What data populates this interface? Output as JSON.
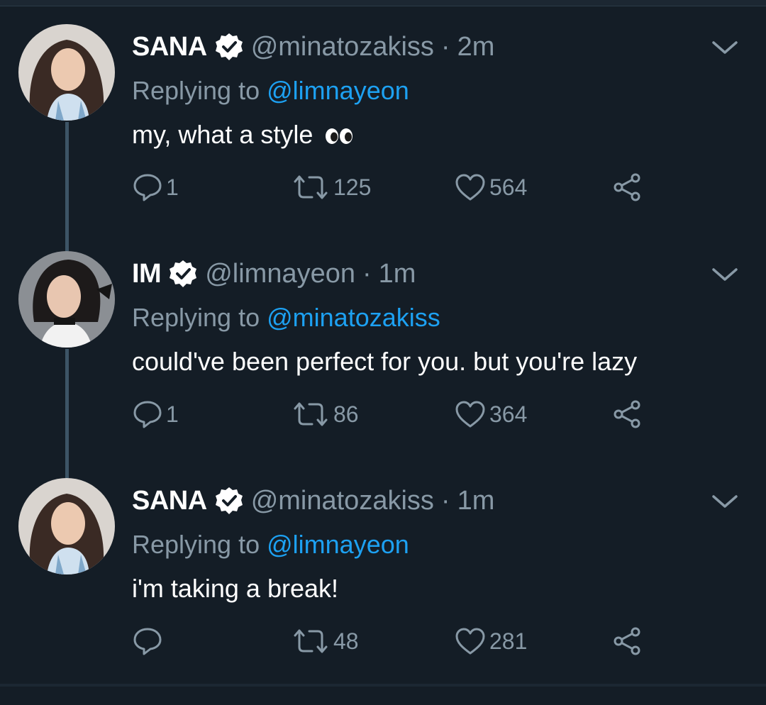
{
  "colors": {
    "background": "#141d26",
    "secondary_text": "#8899a6",
    "mention": "#1da1f2",
    "thread_line": "#3d5466"
  },
  "tweets": [
    {
      "name": "SANA",
      "handle": "@minatozakiss",
      "separator": "·",
      "time": "2m",
      "replying_prefix": "Replying to",
      "replying_to": "@limnayeon",
      "text": "my, what a style",
      "emoji": "eyes-emoji",
      "replies": "1",
      "retweets": "125",
      "likes": "564"
    },
    {
      "name": "IM",
      "handle": "@limnayeon",
      "separator": "·",
      "time": "1m",
      "replying_prefix": "Replying to",
      "replying_to": "@minatozakiss",
      "text": "could've been perfect for you. but you're lazy",
      "replies": "1",
      "retweets": "86",
      "likes": "364"
    },
    {
      "name": "SANA",
      "handle": "@minatozakiss",
      "separator": "·",
      "time": "1m",
      "replying_prefix": "Replying to",
      "replying_to": "@limnayeon",
      "text": "i'm taking a break!",
      "replies": "",
      "retweets": "48",
      "likes": "281"
    }
  ],
  "icons": {
    "verified": "verified-badge-icon",
    "menu": "chevron-down-icon",
    "reply": "reply-bubble-icon",
    "retweet": "retweet-icon",
    "like": "heart-icon",
    "share": "share-icon"
  }
}
